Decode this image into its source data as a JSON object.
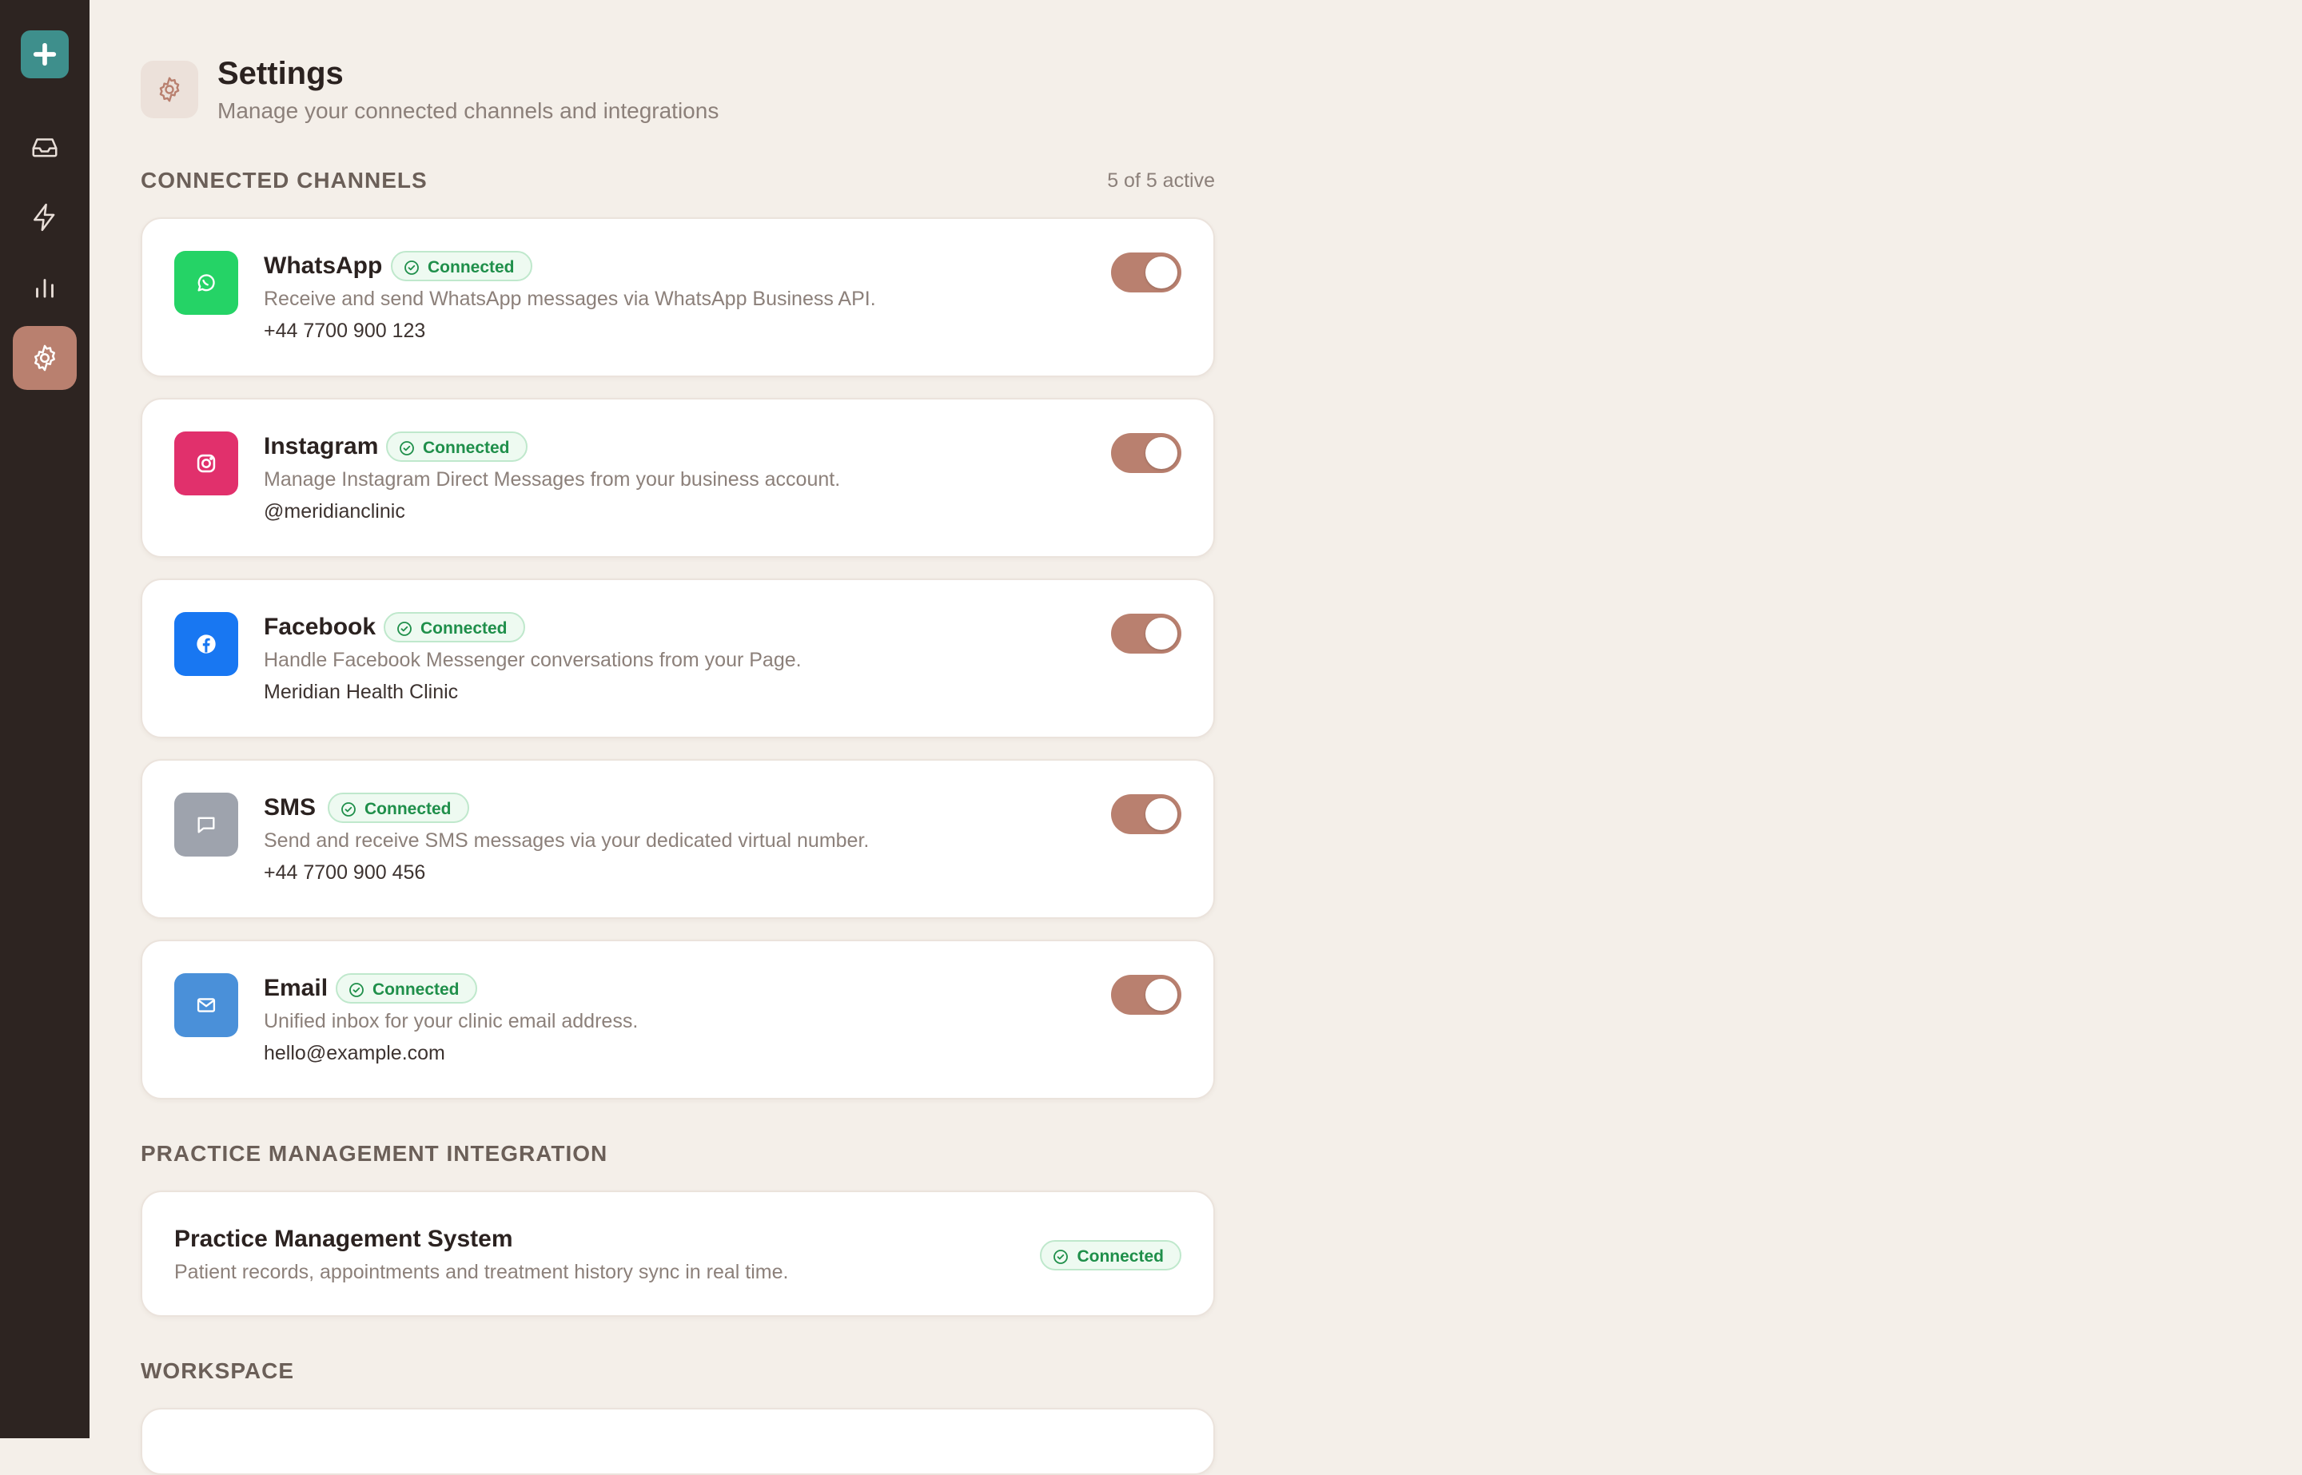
{
  "sidebar": {
    "items": [
      {
        "name": "inbox-icon"
      },
      {
        "name": "lightning-icon"
      },
      {
        "name": "bar-chart-icon"
      },
      {
        "name": "gear-icon",
        "active": true
      }
    ]
  },
  "header": {
    "title": "Settings",
    "subtitle": "Manage your connected channels and integrations"
  },
  "channels_section": {
    "title": "CONNECTED CHANNELS",
    "count": "5 of 5 active"
  },
  "channels": [
    {
      "name": "WhatsApp",
      "status": "Connected",
      "description": "Receive and send WhatsApp messages via WhatsApp Business API.",
      "detail": "+44 7700 900 123",
      "color": "#25d366",
      "icon": "whatsapp-icon",
      "enabled": true
    },
    {
      "name": "Instagram",
      "status": "Connected",
      "description": "Manage Instagram Direct Messages from your business account.",
      "detail": "@meridianclinic",
      "color": "#e1306c",
      "icon": "instagram-icon",
      "enabled": true
    },
    {
      "name": "Facebook",
      "status": "Connected",
      "description": "Handle Facebook Messenger conversations from your Page.",
      "detail": "Meridian Health Clinic",
      "color": "#1877f2",
      "icon": "facebook-icon",
      "enabled": true
    },
    {
      "name": "SMS",
      "status": "Connected",
      "description": "Send and receive SMS messages via your dedicated virtual number.",
      "detail": "+44 7700 900 456",
      "color": "#9ea3ad",
      "icon": "message-icon",
      "enabled": true
    },
    {
      "name": "Email",
      "status": "Connected",
      "description": "Unified inbox for your clinic email address.",
      "detail": "hello@example.com",
      "color": "#4a90d9",
      "icon": "mail-icon",
      "enabled": true
    }
  ],
  "pms_section": {
    "title": "PRACTICE MANAGEMENT INTEGRATION"
  },
  "pms": {
    "title": "Practice Management System",
    "description": "Patient records, appointments and treatment history sync in real time.",
    "status": "Connected"
  },
  "workspace_section": {
    "title": "WORKSPACE"
  },
  "colors": {
    "accent": "#b9806f",
    "sidebar": "#2d2421",
    "logo": "#3e8f8c",
    "success": "#1f8f4a"
  }
}
